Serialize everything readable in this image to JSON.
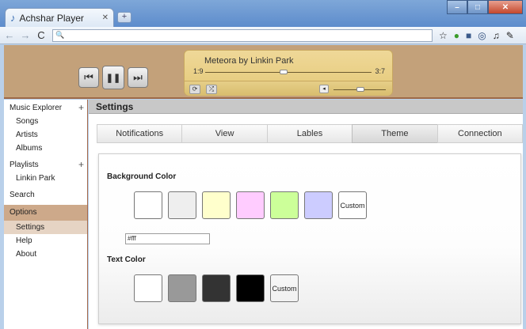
{
  "window": {
    "tab_title": "Achshar Player",
    "tab_close": "✕",
    "new_tab": "+",
    "btn_min": "–",
    "btn_max": "□",
    "btn_close": "✕"
  },
  "toolbar": {
    "back": "←",
    "forward": "→",
    "reload": "C",
    "search_glyph": "🔍",
    "address": ""
  },
  "player": {
    "now_playing": "Meteora by Linkin Park",
    "current_time": "1:9",
    "total_time": "3:7",
    "progress": 0.47,
    "volume": 0.52,
    "prev_glyph": "⏮",
    "pause_glyph": "❚❚",
    "next_glyph": "⏭",
    "repeat_glyph": "⟳",
    "shuffle_glyph": "⤮",
    "volume_glyph": "◂"
  },
  "sidebar": {
    "music_explorer": "Music Explorer",
    "plus": "+",
    "songs": "Songs",
    "artists": "Artists",
    "albums": "Albums",
    "playlists": "Playlists",
    "linkin_park": "Linkin Park",
    "search": "Search",
    "options": "Options",
    "settings": "Settings",
    "help": "Help",
    "about": "About"
  },
  "main": {
    "header": "Settings",
    "tabs": [
      "Notifications",
      "View",
      "Lables",
      "Theme",
      "Connection"
    ],
    "active_tab": "Theme",
    "background_color_label": "Background Color",
    "background_swatches": [
      "#ffffff",
      "#eeeeee",
      "#ffffcc",
      "#ffccff",
      "#ccff99",
      "#ccccff"
    ],
    "custom_label": "Custom",
    "hex_value": "#fff",
    "text_color_label": "Text Color",
    "text_swatches": [
      "#ffffff",
      "#999999",
      "#333333",
      "#000000"
    ]
  },
  "colors": {
    "player_bg": "#c3a17a",
    "now_playing_bg": "#e8cd80",
    "sidebar_options_bg": "#cda98a",
    "sidebar_settings_bg": "#e6d4c4"
  }
}
